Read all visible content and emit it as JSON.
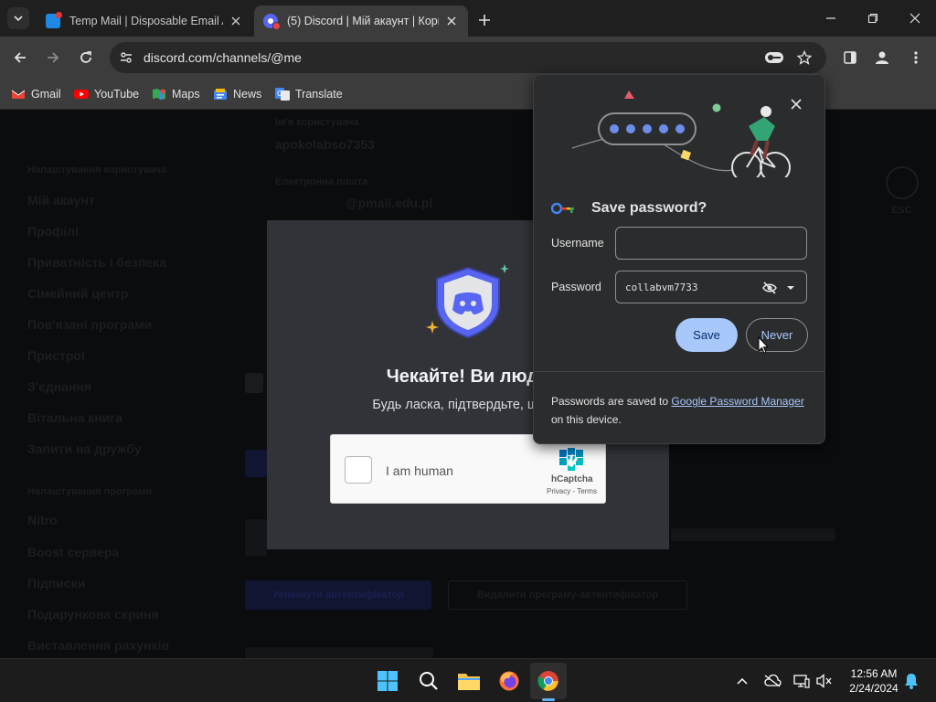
{
  "browser": {
    "tabs": [
      {
        "title": "Temp Mail | Disposable Email A",
        "active": false
      },
      {
        "title": "(5) Discord | Мій акаунт | Кори",
        "active": true
      }
    ],
    "new_tab": "+",
    "address": "discord.com/channels/@me",
    "bookmarks": [
      "Gmail",
      "YouTube",
      "Maps",
      "News",
      "Translate"
    ]
  },
  "discord": {
    "account_fields": {
      "username_label": "Ім'я користувача",
      "username_value": "apokolabso7353",
      "email_label": "Електронна пошта",
      "email_value": "@pmail.edu.pl"
    },
    "sidebar": {
      "section": "Налаштування користувача",
      "items": [
        "Мій акаунт",
        "Профілі",
        "Приватність і безпека",
        "Сімейний центр",
        "Пов'язані програми",
        "Пристрої",
        "З'єднання",
        "Вітальна книга",
        "Запити на дружбу"
      ],
      "section2": "Налаштування програми",
      "items2": [
        "Nitro",
        "Boost сервера",
        "Підписки",
        "Подарункова скриня",
        "Виставлення рахунків"
      ]
    },
    "buttons": {
      "auth_app": "Увімкнути автентифікатор",
      "remove_app": "Видалити програму-автентифікатор"
    },
    "esc_label": "ESC"
  },
  "captcha_modal": {
    "title": "Чекайте! Ви люди",
    "subtitle": "Будь ласка, підтвердьте, що ви",
    "checkbox_label": "I am human",
    "brand": "hCaptcha",
    "terms": "Privacy - Terms"
  },
  "password_bubble": {
    "title": "Save password?",
    "username_label": "Username",
    "username_value": "",
    "password_label": "Password",
    "password_value": "collabvm7733",
    "save_label": "Save",
    "never_label": "Never",
    "footer_prefix": "Passwords are saved to ",
    "footer_link": "Google Password Manager",
    "footer_suffix": " on this device."
  },
  "taskbar": {
    "time": "12:56 AM",
    "date": "2/24/2024"
  },
  "colors": {
    "discord_blurple": "#5865f2",
    "chrome_blue": "#a8c7fa"
  }
}
